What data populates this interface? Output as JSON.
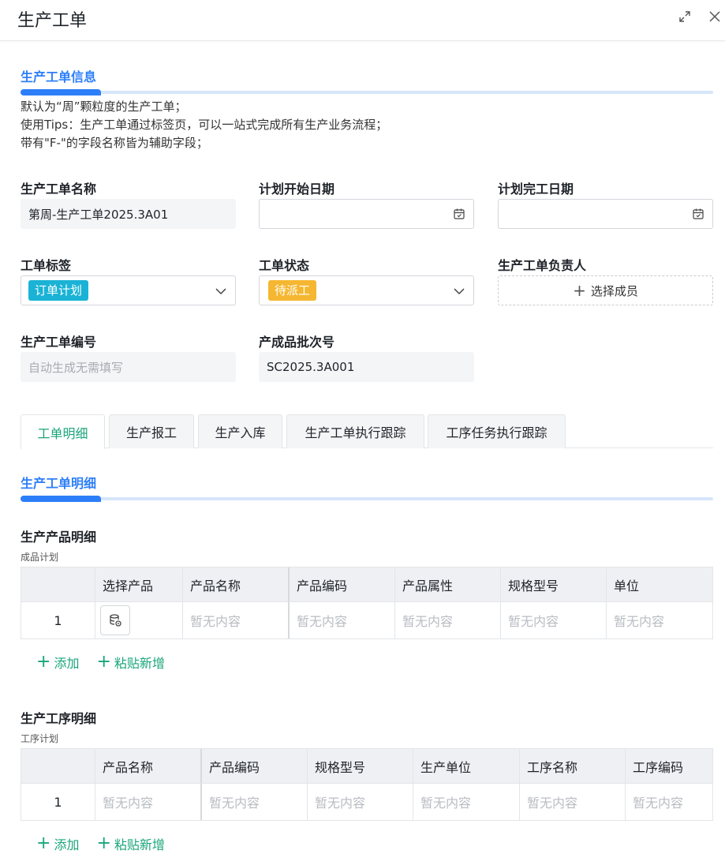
{
  "header": {
    "title": "生产工单"
  },
  "info_section": {
    "title": "生产工单信息",
    "desc_lines": [
      "默认为“周”颗粒度的生产工单；",
      "使用Tips：生产工单通过标签页，可以一站式完成所有生产业务流程；",
      "带有\"F-\"的字段名称皆为辅助字段；"
    ]
  },
  "fields": {
    "name": {
      "label": "生产工单名称",
      "value": "第周-生产工单2025.3A01"
    },
    "plan_start": {
      "label": "计划开始日期",
      "value": ""
    },
    "plan_end": {
      "label": "计划完工日期",
      "value": ""
    },
    "tag": {
      "label": "工单标签",
      "value": "订单计划"
    },
    "status": {
      "label": "工单状态",
      "value": "待派工"
    },
    "owner": {
      "label": "生产工单负责人",
      "button": "选择成员"
    },
    "number": {
      "label": "生产工单编号",
      "placeholder": "自动生成无需填写"
    },
    "batch": {
      "label": "产成品批次号",
      "value": "SC2025.3A001"
    }
  },
  "tabs": [
    "工单明细",
    "生产报工",
    "生产入库",
    "生产工单执行跟踪",
    "工序任务执行跟踪"
  ],
  "detail_section": {
    "title": "生产工单明细"
  },
  "product_table": {
    "title": "生产产品明细",
    "caption": "成品计划",
    "headers": [
      "",
      "选择产品",
      "产品名称",
      "产品编码",
      "产品属性",
      "规格型号",
      "单位"
    ],
    "row": [
      "1",
      "",
      "暂无内容",
      "暂无内容",
      "暂无内容",
      "暂无内容",
      "暂无内容"
    ],
    "add": "添加",
    "paste": "粘贴新增"
  },
  "process_table": {
    "title": "生产工序明细",
    "caption": "工序计划",
    "headers": [
      "",
      "产品名称",
      "产品编码",
      "规格型号",
      "生产单位",
      "工序名称",
      "工序编码"
    ],
    "row": [
      "1",
      "暂无内容",
      "暂无内容",
      "暂无内容",
      "暂无内容",
      "暂无内容",
      "暂无内容"
    ],
    "add": "添加",
    "paste": "粘贴新增"
  },
  "colors": {
    "primary_blue": "#2d7ff9",
    "green": "#1aa57a",
    "tag_cyan": "#1ab3d6",
    "tag_amber": "#f5b731"
  }
}
